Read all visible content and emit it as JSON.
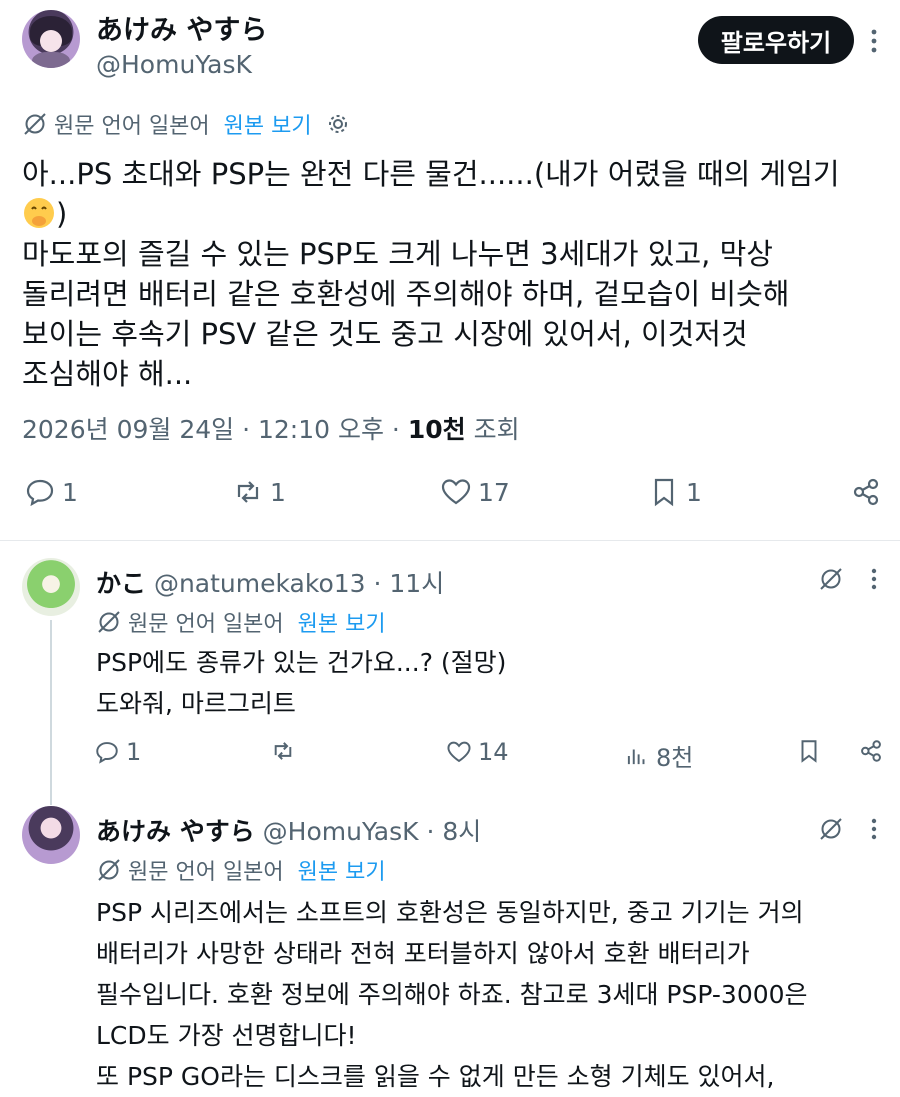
{
  "post": {
    "display_name": "あけみ やすら",
    "handle": "@HomuYasK",
    "follow_label": "팔로우하기",
    "translate_label": "원문 언어 일본어",
    "translate_link": "원본 보기",
    "body_line1": "아...PS 초대와 PSP는 완전 다른 물건......(내가 어렸을 때의 게임기",
    "body_line2_suffix": ")",
    "body_rest": "마도포의 즐길 수 있는 PSP도 크게 나누면 3세대가 있고, 막상\n돌리려면 배터리 같은 호환성에 주의해야 하며, 겉모습이 비슷해\n보이는 후속기 PSV 같은 것도 중고 시장에 있어서, 이것저것\n조심해야 해...",
    "date": "2026년 09월 24일 · 12:10 오후 · ",
    "views_count": "10천",
    "views_label": " 조회",
    "replies": "1",
    "reposts": "1",
    "likes": "17",
    "bookmarks": "1"
  },
  "reply1": {
    "name": "かこ",
    "handle_time": " @natumekako13 · 11시",
    "translate_label": "원문 언어 일본어",
    "translate_link": "원본 보기",
    "body": "PSP에도 종류가 있는 건가요...? (절망)\n도와줘, 마르그리트",
    "replies": "1",
    "likes": "14",
    "views": "8천"
  },
  "reply2": {
    "name": "あけみ やすら",
    "handle_time": " @HomuYasK · 8시",
    "translate_label": "원문 언어 일본어",
    "translate_link": "원본 보기",
    "body": "PSP 시리즈에서는 소프트의 호환성은 동일하지만, 중고 기기는 거의\n배터리가 사망한 상태라 전혀 포터블하지 않아서 호환 배터리가\n필수입니다. 호환 정보에 주의해야 하죠. 참고로 3세대 PSP-3000은\nLCD도 가장 선명합니다!\n또 PSP GO라는 디스크를 읽을 수 없게 만든 소형 기체도 있어서,"
  },
  "colors": {
    "text": "#0f1419",
    "secondary": "#536471",
    "link": "#1d9bf0",
    "button_bg": "#0f1419"
  }
}
